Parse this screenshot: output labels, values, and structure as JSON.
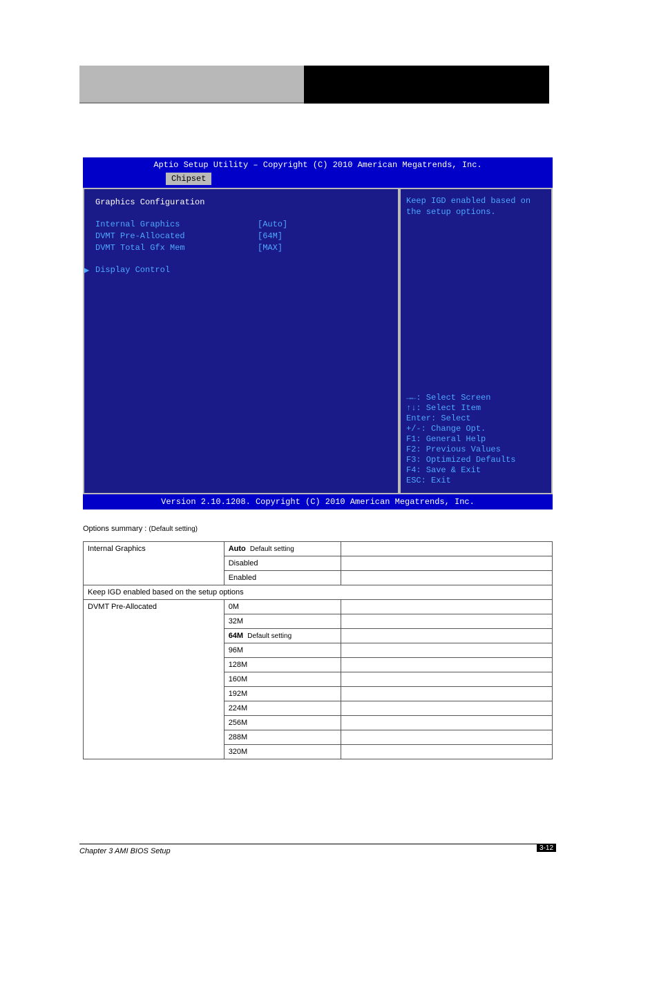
{
  "header": {
    "right_text": ""
  },
  "bios": {
    "title": "Aptio Setup Utility – Copyright (C) 2010 American Megatrends, Inc.",
    "tab": "Chipset",
    "section": "Graphics Configuration",
    "options": [
      {
        "label": "Internal Graphics",
        "value": "[Auto]"
      },
      {
        "label": "DVMT Pre-Allocated",
        "value": "[64M]"
      },
      {
        "label": "DVMT Total Gfx Mem",
        "value": "[MAX]"
      }
    ],
    "submenu": "Display Control",
    "help": "Keep IGD enabled based on the setup options.",
    "hints": [
      "→←: Select Screen",
      "↑↓: Select Item",
      "Enter: Select",
      "+/-: Change Opt.",
      "F1: General Help",
      "F2: Previous Values",
      "F3: Optimized Defaults",
      "F4: Save & Exit",
      "ESC: Exit"
    ],
    "bottom": "Version 2.10.1208. Copyright (C) 2010 American Megatrends, Inc."
  },
  "doc": {
    "options_label": "Options summary :",
    "default_label": "Default setting",
    "rows": [
      {
        "c1": "Internal Graphics",
        "c2": "Auto",
        "c3": "",
        "rowspan": 3,
        "default": true
      },
      {
        "c2": "Disabled",
        "c3": ""
      },
      {
        "c2": "Enabled",
        "c3": ""
      }
    ],
    "full1": "Keep IGD enabled based on the setup options",
    "rows2": [
      {
        "c1": "DVMT Pre-Allocated",
        "c2": "0M",
        "c3": "",
        "rowspan": 11
      },
      {
        "c2": "32M",
        "c3": ""
      },
      {
        "c2": "64M",
        "c3": "",
        "default": true
      },
      {
        "c2": "96M",
        "c3": ""
      },
      {
        "c2": "128M",
        "c3": ""
      },
      {
        "c2": "160M",
        "c3": ""
      },
      {
        "c2": "192M",
        "c3": ""
      },
      {
        "c2": "224M",
        "c3": ""
      },
      {
        "c2": "256M",
        "c3": ""
      },
      {
        "c2": "288M",
        "c3": ""
      },
      {
        "c2": "320M",
        "c3": ""
      }
    ]
  },
  "footer": {
    "left": "Chapter 3 AMI BIOS Setup",
    "right": "3-12"
  }
}
